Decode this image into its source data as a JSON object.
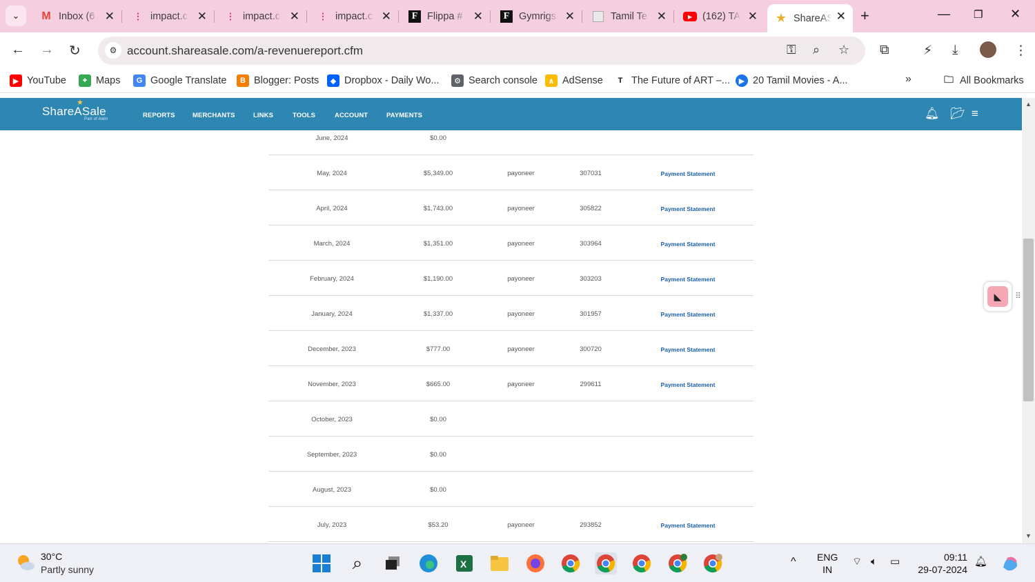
{
  "browser": {
    "tabs": [
      {
        "title": "Inbox (6",
        "favicon": "gmail-icon"
      },
      {
        "title": "impact.c",
        "favicon": "impact-icon"
      },
      {
        "title": "impact.c",
        "favicon": "impact-icon"
      },
      {
        "title": "impact.c",
        "favicon": "impact-icon"
      },
      {
        "title": "Flippa #",
        "favicon": "flippa-icon"
      },
      {
        "title": "Gymrigs",
        "favicon": "flippa-icon"
      },
      {
        "title": "Tamil Te",
        "favicon": "page-icon"
      },
      {
        "title": "(162) TA",
        "favicon": "youtube-icon"
      },
      {
        "title": "ShareAS",
        "favicon": "star-icon",
        "active": true
      }
    ],
    "url": "account.shareasale.com/a-revenuereport.cfm",
    "bookmarks": [
      {
        "label": "YouTube",
        "icon": "youtube-icon"
      },
      {
        "label": "Maps",
        "icon": "maps-icon"
      },
      {
        "label": "Google Translate",
        "icon": "translate-icon"
      },
      {
        "label": "Blogger: Posts",
        "icon": "blogger-icon"
      },
      {
        "label": "Dropbox - Daily Wo...",
        "icon": "dropbox-icon"
      },
      {
        "label": "Search console",
        "icon": "search-console-icon"
      },
      {
        "label": "AdSense",
        "icon": "adsense-icon"
      },
      {
        "label": "The Future of ART –...",
        "icon": "t-icon"
      },
      {
        "label": "20 Tamil Movies - A...",
        "icon": "play-icon"
      }
    ],
    "all_bookmarks": "All Bookmarks"
  },
  "site": {
    "logo": "ShareASale",
    "logo_sub": "Part of Awin",
    "nav": [
      "REPORTS",
      "MERCHANTS",
      "LINKS",
      "TOOLS",
      "ACCOUNT",
      "PAYMENTS"
    ]
  },
  "rows": [
    {
      "month": "June, 2024",
      "amount": "$0.00",
      "method": "",
      "id": "",
      "link": ""
    },
    {
      "month": "May, 2024",
      "amount": "$5,349.00",
      "method": "payoneer",
      "id": "307031",
      "link": "Payment Statement"
    },
    {
      "month": "April, 2024",
      "amount": "$1,743.00",
      "method": "payoneer",
      "id": "305822",
      "link": "Payment Statement"
    },
    {
      "month": "March, 2024",
      "amount": "$1,351.00",
      "method": "payoneer",
      "id": "303964",
      "link": "Payment Statement"
    },
    {
      "month": "February, 2024",
      "amount": "$1,190.00",
      "method": "payoneer",
      "id": "303203",
      "link": "Payment Statement"
    },
    {
      "month": "January, 2024",
      "amount": "$1,337.00",
      "method": "payoneer",
      "id": "301957",
      "link": "Payment Statement"
    },
    {
      "month": "December, 2023",
      "amount": "$777.00",
      "method": "payoneer",
      "id": "300720",
      "link": "Payment Statement"
    },
    {
      "month": "November, 2023",
      "amount": "$665.00",
      "method": "payoneer",
      "id": "299611",
      "link": "Payment Statement"
    },
    {
      "month": "October, 2023",
      "amount": "$0.00",
      "method": "",
      "id": "",
      "link": ""
    },
    {
      "month": "September, 2023",
      "amount": "$0.00",
      "method": "",
      "id": "",
      "link": ""
    },
    {
      "month": "August, 2023",
      "amount": "$0.00",
      "method": "",
      "id": "",
      "link": ""
    },
    {
      "month": "July, 2023",
      "amount": "$53.20",
      "method": "payoneer",
      "id": "293852",
      "link": "Payment Statement"
    }
  ],
  "taskbar": {
    "weather_temp": "30°C",
    "weather_desc": "Partly sunny",
    "lang_top": "ENG",
    "lang_bottom": "IN",
    "time": "09:11",
    "date": "29-07-2024"
  },
  "colors": {
    "tabstrip": "#f5cfe0",
    "site_nav": "#2e87b3",
    "link": "#1b5fa8"
  }
}
